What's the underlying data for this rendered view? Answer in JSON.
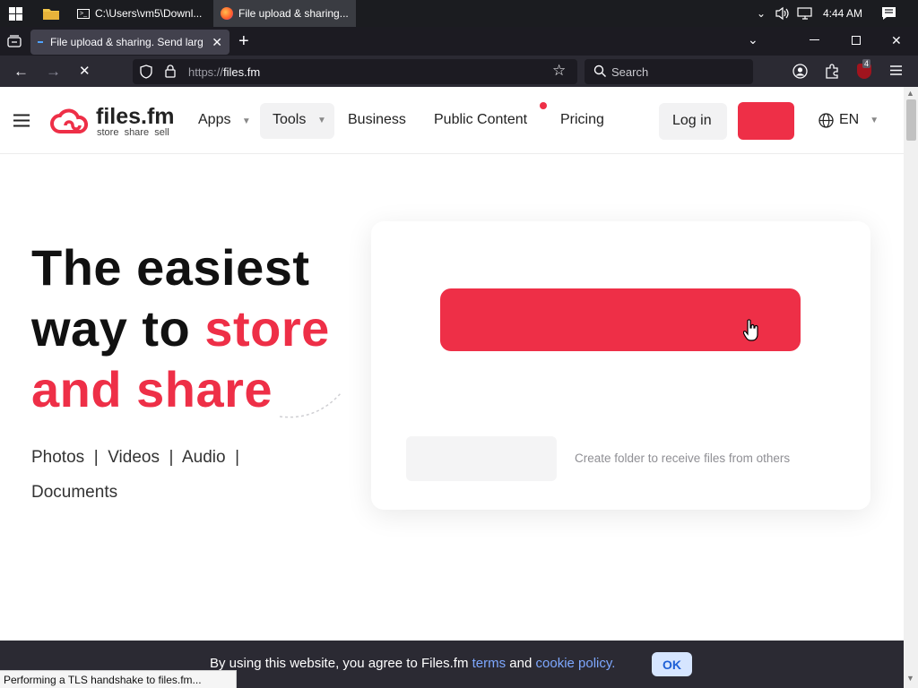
{
  "taskbar": {
    "tasks": [
      {
        "label": "C:\\Users\\vm5\\Downl..."
      },
      {
        "label": "File upload & sharing..."
      }
    ],
    "clock": "4:44 AM"
  },
  "browser": {
    "tab_title": "File upload & sharing. Send larg",
    "url_scheme": "https://",
    "url_host": "files.fm",
    "search_placeholder": "Search",
    "extension_badge": "4"
  },
  "site": {
    "logo_name": "files.fm",
    "logo_tagline": "store  share  sell",
    "nav": {
      "apps": "Apps",
      "tools": "Tools",
      "business": "Business",
      "public_content": "Public Content",
      "pricing": "Pricing"
    },
    "login_label": "Log in",
    "language": "EN",
    "brand_color": "#ee2f47"
  },
  "hero": {
    "line1": "The easiest",
    "line2_black": "way to ",
    "line2_red": "store",
    "line3_red": "and share",
    "media_line1": "Photos  |  Videos  |  Audio  |",
    "media_line2": "Documents"
  },
  "upload_card": {
    "folder_text": "Create folder to receive files from others"
  },
  "cookie": {
    "text_before": "By using this website, you agree to Files.fm ",
    "terms_link": "terms",
    "text_and": " and ",
    "cookie_link": "cookie policy.",
    "ok_label": "OK"
  },
  "status_text": "Performing a TLS handshake to files.fm..."
}
